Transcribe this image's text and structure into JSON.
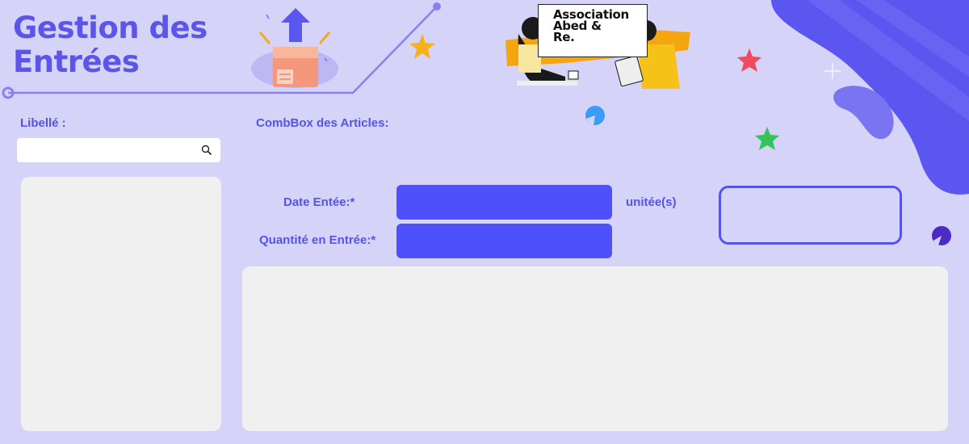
{
  "header": {
    "title_line1": "Gestion des",
    "title_line2": "Entrées",
    "logo_line1": "Association",
    "logo_line2": "Abed &",
    "logo_line3": "Re."
  },
  "sidebar": {
    "label": "Libellé :",
    "search_value": "",
    "search_icon": "search-icon"
  },
  "form": {
    "combobox_label": "CombBox des Articles:",
    "date_label": "Date Entée:*",
    "date_value": "",
    "quantity_label": "Quantité en Entrée:*",
    "quantity_value": "",
    "unit_label": "unitée(s)"
  },
  "colors": {
    "background": "#d6d3f9",
    "accent": "#5553e8",
    "field": "#4e4ffd",
    "panel": "#f0f0f0"
  }
}
